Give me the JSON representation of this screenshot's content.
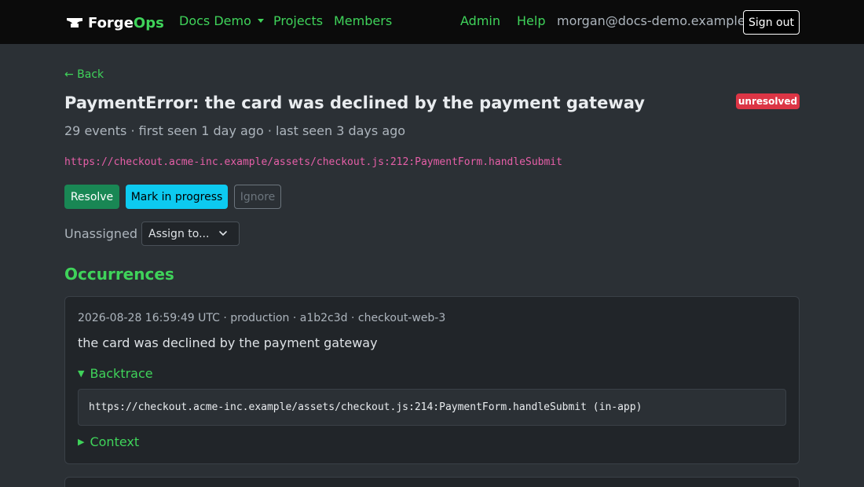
{
  "nav": {
    "brand_part1": "Forge",
    "brand_part2": "Ops",
    "org": "Docs Demo",
    "projects": "Projects",
    "members": "Members",
    "admin": "Admin",
    "help": "Help",
    "user": "morgan@docs-demo.example",
    "signout": "Sign out"
  },
  "issue": {
    "back": "← Back",
    "title": "PaymentError: the card was declined by the payment gateway",
    "status": "unresolved",
    "meta": "29 events · first seen 1 day ago · last seen 3 days ago",
    "location": "https://checkout.acme-inc.example/assets/checkout.js:212:PaymentForm.handleSubmit"
  },
  "actions": {
    "resolve": "Resolve",
    "in_progress": "Mark in progress",
    "ignore": "Ignore"
  },
  "assign": {
    "label": "Unassigned",
    "select_value": "Assign to..."
  },
  "occurrences": {
    "heading": "Occurrences",
    "items": [
      {
        "meta": "2026-08-28 16:59:49 UTC · production · a1b2c3d · checkout-web-3",
        "message": "the card was declined by the payment gateway",
        "backtrace_label": "Backtrace",
        "backtrace_line": "https://checkout.acme-inc.example/assets/checkout.js:214:PaymentForm.handleSubmit (in-app)",
        "context_label": "Context"
      }
    ]
  },
  "colors": {
    "accent": "#3fd35a",
    "danger": "#dc3545",
    "info": "#0dcaf0",
    "success": "#198754",
    "code_pink": "#e65fa8"
  },
  "icons": {
    "logo": "anvil-icon",
    "org_dropdown": "caret-down-icon",
    "select": "chevron-down-icon",
    "backtrace_toggle": "triangle-down-icon",
    "context_toggle": "triangle-right-icon"
  }
}
